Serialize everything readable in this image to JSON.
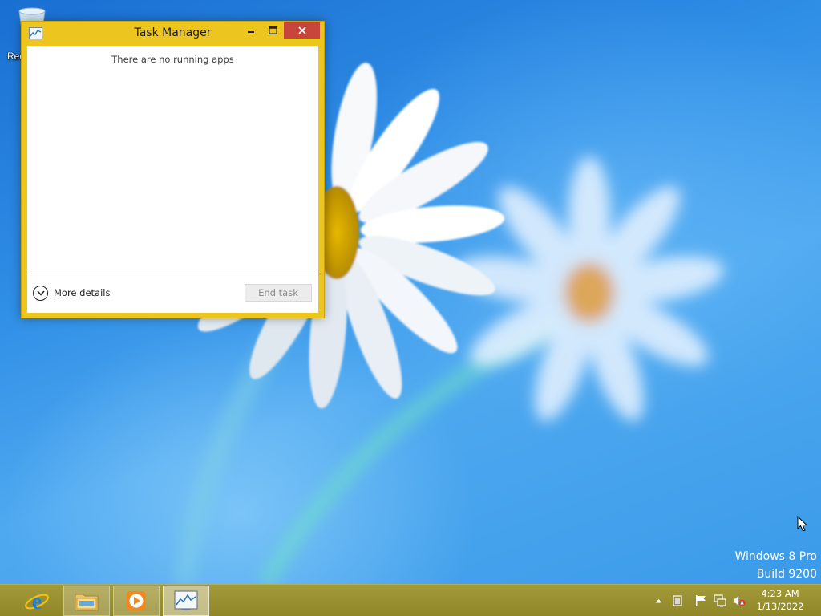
{
  "desktop": {
    "recycle_bin_label": "Rec"
  },
  "window": {
    "title": "Task Manager",
    "empty_message": "There are no running apps",
    "more_details_label": "More details",
    "end_task_label": "End task",
    "accent_color": "#ecc51f",
    "close_color": "#c7453a"
  },
  "watermark": {
    "line1": "Windows 8 Pro",
    "line2": "Build 9200"
  },
  "taskbar": {
    "apps": [
      {
        "name": "internet-explorer"
      },
      {
        "name": "file-explorer"
      },
      {
        "name": "windows-media-player"
      },
      {
        "name": "task-manager"
      }
    ],
    "tray_icons": [
      "chevron-up-icon",
      "ime-icon",
      "action-center-flag-icon",
      "network-icon",
      "volume-muted-icon"
    ],
    "clock": {
      "time": "4:23 AM",
      "date": "1/13/2022"
    },
    "color": "#978f30"
  }
}
